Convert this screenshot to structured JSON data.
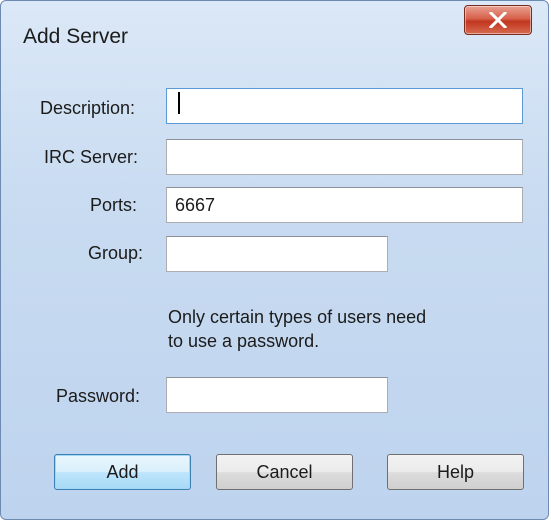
{
  "window": {
    "title": "Add Server"
  },
  "form": {
    "description": {
      "label": "Description:",
      "value": ""
    },
    "irc_server": {
      "label": "IRC Server:",
      "value": ""
    },
    "ports": {
      "label": "Ports:",
      "value": "6667"
    },
    "group": {
      "label": "Group:",
      "value": ""
    },
    "info_line1": "Only certain types of users need",
    "info_line2": "to use a password.",
    "password": {
      "label": "Password:",
      "value": ""
    }
  },
  "buttons": {
    "add": "Add",
    "cancel": "Cancel",
    "help": "Help"
  },
  "icons": {
    "close": "close-icon"
  },
  "colors": {
    "close_button": "#c7432b",
    "default_button_border": "#3c7fb1",
    "focus_border": "#5b9bd5"
  }
}
